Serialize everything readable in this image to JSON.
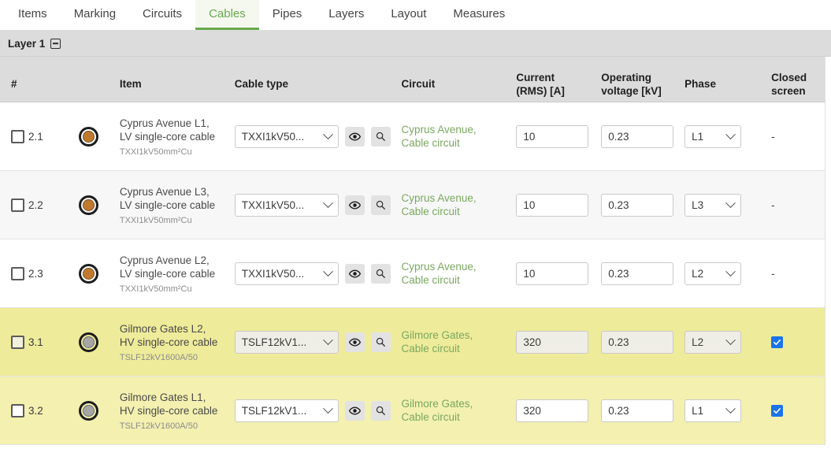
{
  "tabs": [
    {
      "label": "Items",
      "active": false
    },
    {
      "label": "Marking",
      "active": false
    },
    {
      "label": "Circuits",
      "active": false
    },
    {
      "label": "Cables",
      "active": true
    },
    {
      "label": "Pipes",
      "active": false
    },
    {
      "label": "Layers",
      "active": false
    },
    {
      "label": "Layout",
      "active": false
    },
    {
      "label": "Measures",
      "active": false
    }
  ],
  "layer": {
    "title": "Layer 1",
    "collapse_icon": "collapse-minus-icon"
  },
  "table": {
    "headers": {
      "num": "#",
      "item": "Item",
      "cable_type": "Cable type",
      "circuit": "Circuit",
      "current": "Current\n(RMS) [A]",
      "current_l1": "Current",
      "current_l2": "(RMS) [A]",
      "voltage_l1": "Operating",
      "voltage_l2": "voltage [kV]",
      "phase": "Phase",
      "closed_l1": "Closed",
      "closed_l2": "screen"
    },
    "rows": [
      {
        "num": "2.1",
        "icon": "cable-cross-section-copper-icon",
        "icon_color": "#c07a30",
        "item_name": "Cyprus Avenue L1, LV single-core cable",
        "item_sub": "TXXI1kV50mm²Cu",
        "cable_type": "TXXI1kV50...",
        "circuit": "Cyprus Avenue, Cable circuit",
        "current": "10",
        "voltage": "0.23",
        "phase": "L1",
        "closed_screen": "-",
        "closed_checked": false,
        "selected": false,
        "stripe": false,
        "highlight": "none"
      },
      {
        "num": "2.2",
        "icon": "cable-cross-section-copper-icon",
        "icon_color": "#c07a30",
        "item_name": "Cyprus Avenue L3, LV single-core cable",
        "item_sub": "TXXI1kV50mm²Cu",
        "cable_type": "TXXI1kV50...",
        "circuit": "Cyprus Avenue, Cable circuit",
        "current": "10",
        "voltage": "0.23",
        "phase": "L3",
        "closed_screen": "-",
        "closed_checked": false,
        "selected": false,
        "stripe": true,
        "highlight": "none"
      },
      {
        "num": "2.3",
        "icon": "cable-cross-section-copper-icon",
        "icon_color": "#c07a30",
        "item_name": "Cyprus Avenue L2, LV single-core cable",
        "item_sub": "TXXI1kV50mm²Cu",
        "cable_type": "TXXI1kV50...",
        "circuit": "Cyprus Avenue, Cable circuit",
        "current": "10",
        "voltage": "0.23",
        "phase": "L2",
        "closed_screen": "-",
        "closed_checked": false,
        "selected": false,
        "stripe": false,
        "highlight": "none"
      },
      {
        "num": "3.1",
        "icon": "cable-cross-section-aluminium-icon",
        "icon_color": "#a6a6a6",
        "item_name": "Gilmore Gates L2, HV single-core cable",
        "item_sub": "TSLF12kV1600A/50",
        "cable_type": "TSLF12kV1...",
        "circuit": "Gilmore Gates, Cable circuit",
        "current": "320",
        "voltage": "0.23",
        "phase": "L2",
        "closed_screen": "",
        "closed_checked": true,
        "selected": true,
        "stripe": false,
        "highlight": "strong"
      },
      {
        "num": "3.2",
        "icon": "cable-cross-section-aluminium-icon",
        "icon_color": "#a6a6a6",
        "item_name": "Gilmore Gates L1, HV single-core cable",
        "item_sub": "TSLF12kV1600A/50",
        "cable_type": "TSLF12kV1...",
        "circuit": "Gilmore Gates, Cable circuit",
        "current": "320",
        "voltage": "0.23",
        "phase": "L1",
        "closed_screen": "",
        "closed_checked": true,
        "selected": false,
        "stripe": false,
        "highlight": "light"
      }
    ]
  },
  "icons": {
    "preview": "eye-icon",
    "search": "magnifier-icon",
    "dropdown": "chevron-down-icon",
    "checkbox": "checkbox-icon"
  },
  "colors": {
    "accent_green": "#6aa84f",
    "link_green": "#7aa860",
    "highlight_strong": "#eeeb9a",
    "highlight_light": "#f3f0b0",
    "checkbox_blue": "#1a73e8",
    "header_grey": "#dcdcdc"
  }
}
